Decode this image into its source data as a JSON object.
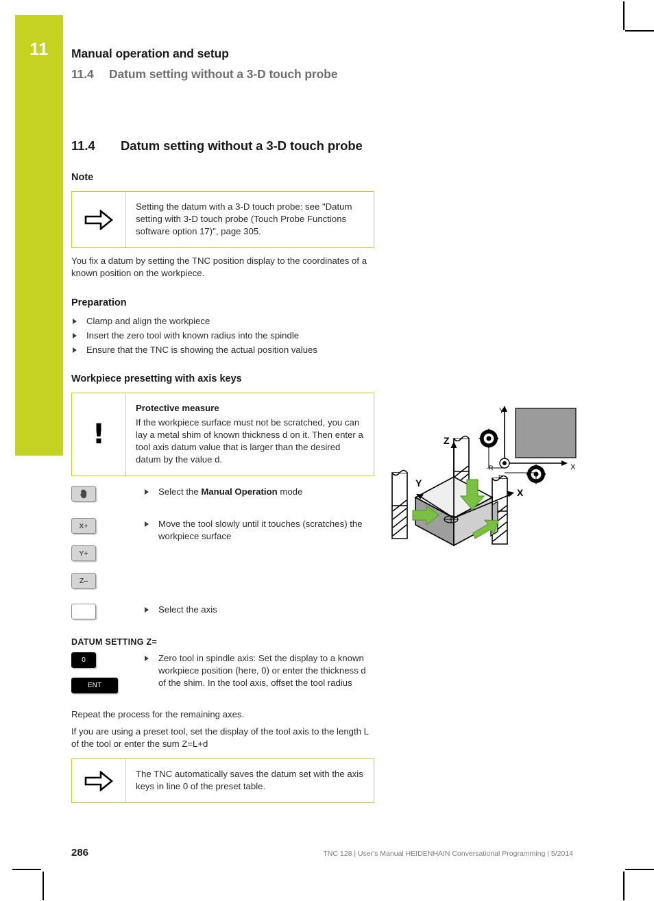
{
  "header": {
    "chapter_number": "11",
    "chapter_title": "Manual operation and setup",
    "section_number": "11.4",
    "section_title": "Datum setting without a 3-D touch probe"
  },
  "section": {
    "number": "11.4",
    "title": "Datum setting without a 3-D touch probe"
  },
  "note_heading": "Note",
  "note_box": {
    "icon": "arrow-right-icon",
    "text": "Setting the datum with a 3-D touch probe: see \"Datum setting with 3-D touch probe (Touch Probe Functions software option 17)\", page 305."
  },
  "intro_paragraph": "You fix a datum by setting the TNC position display to the coordinates of a known position on the workpiece.",
  "preparation": {
    "heading": "Preparation",
    "items": [
      "Clamp and align the workpiece",
      "Insert the zero tool with known radius into the spindle",
      "Ensure that the TNC is showing the actual position values"
    ]
  },
  "presetting": {
    "heading": "Workpiece presetting with axis keys"
  },
  "warning_box": {
    "icon": "exclamation-icon",
    "title": "Protective measure",
    "text": "If the workpiece surface must not be scratched, you can lay a metal shim of known thickness d on it. Then enter a tool axis datum value that is larger than the desired datum by the value d."
  },
  "steps": [
    {
      "keys": [
        {
          "label": "",
          "style": "hand"
        }
      ],
      "text_before": "Select the ",
      "text_bold": "Manual Operation",
      "text_after": " mode"
    },
    {
      "keys": [
        {
          "label": "X+",
          "style": "grey"
        },
        {
          "label": "Y+",
          "style": "grey"
        },
        {
          "label": "Z–",
          "style": "grey"
        }
      ],
      "text": "Move the tool slowly until it touches (scratches) the workpiece surface"
    },
    {
      "keys": [
        {
          "label": "",
          "style": "white"
        }
      ],
      "text": "Select the axis"
    }
  ],
  "datum_setting": {
    "heading": "DATUM SETTING Z=",
    "keys": [
      {
        "label": "0",
        "style": "black"
      },
      {
        "label": "ENT",
        "style": "black-wide"
      }
    ],
    "text": "Zero tool in spindle axis: Set the display to a known workpiece position (here, 0) or enter the thickness d of the shim. In the tool axis, offset the tool radius"
  },
  "closing": {
    "paragraph_1": "Repeat the process for the remaining axes.",
    "paragraph_2": "If you are using a preset tool, set the display of the tool axis to the length L of the tool or enter the sum Z=L+d"
  },
  "final_note": {
    "icon": "arrow-right-icon",
    "text": "The TNC automatically saves the datum set with the axis keys in line 0 of the preset table."
  },
  "figure": {
    "axis_labels": {
      "x": "X",
      "y": "Y",
      "z": "Z"
    },
    "inset_labels": {
      "x": "X",
      "y": "Y",
      "radius_1": "-R",
      "radius_2": "-R"
    }
  },
  "footer": {
    "page_number": "286",
    "meta": "TNC 128 | User's Manual HEIDENHAIN Conversational Programming | 5/2014"
  },
  "colors": {
    "accent_green": "#c4d221",
    "arrow_green": "#7ac143",
    "header_grey": "#6f6f6f"
  }
}
